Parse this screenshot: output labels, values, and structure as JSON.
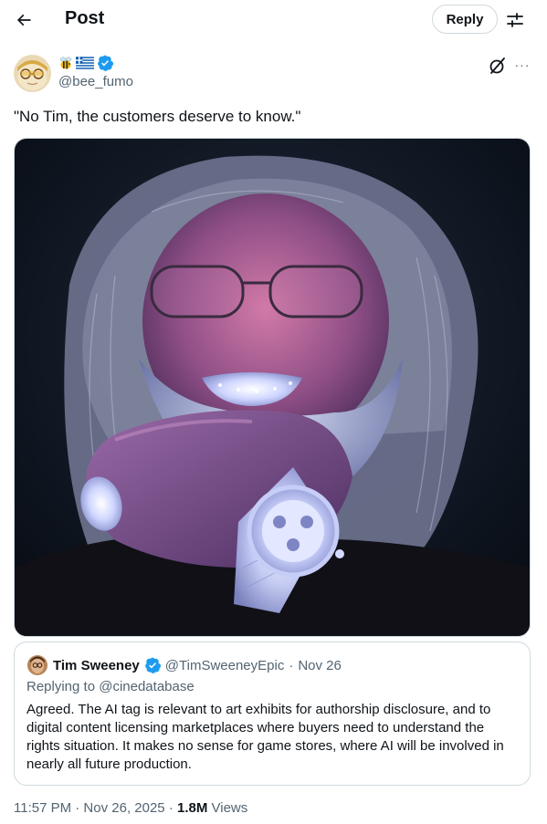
{
  "header": {
    "title": "Post",
    "reply_label": "Reply"
  },
  "post": {
    "handle": "@bee_fumo",
    "text": "\"No Tim, the customers deserve to know.\"",
    "more_label": "···",
    "media_alt": "Photo"
  },
  "quote": {
    "name": "Tim Sweeney",
    "handle": "@TimSweeneyEpic",
    "dot": "·",
    "date": "Nov 26",
    "replying_prefix": "Replying to ",
    "replying_handle": "@cinedatabase",
    "body": "Agreed. The AI tag is relevant to art exhibits for authorship disclosure, and to\ndigital content licensing marketplaces where buyers need to understand the\nrights situation. It makes no sense for game stores, where AI will be involved in\nnearly all future production."
  },
  "meta": {
    "time": "11:57 PM · Nov 26, 2025 · ",
    "views_count": "1.8M",
    "views_label": " Views"
  },
  "colors": {
    "primary_text": "#0f1419",
    "secondary_text": "#536471",
    "verified": "#1d9bf0",
    "border": "#cfd9de"
  }
}
